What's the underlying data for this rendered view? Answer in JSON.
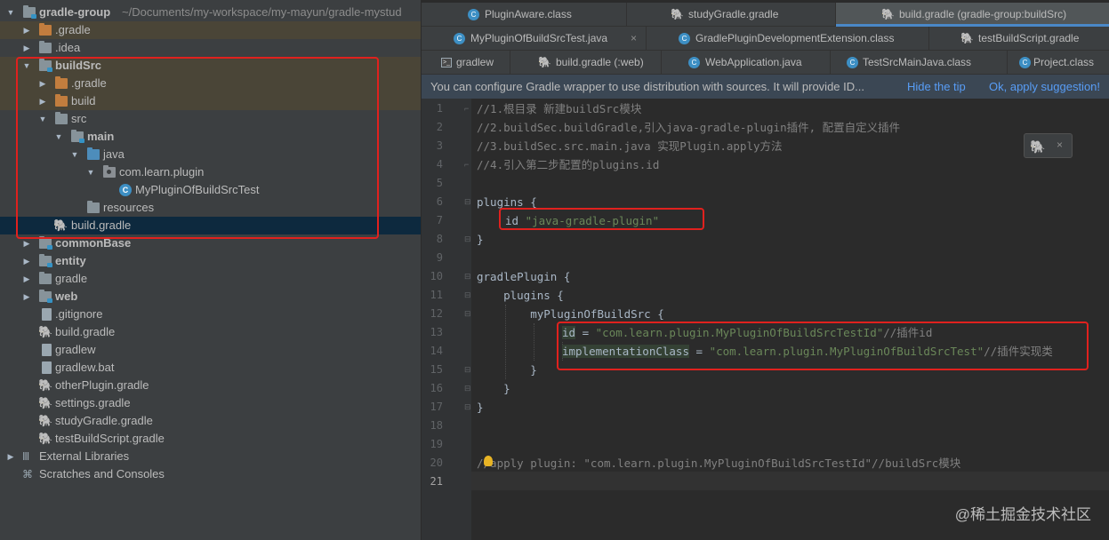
{
  "project": {
    "root_name": "gradle-group",
    "root_path": "~/Documents/my-workspace/my-mayun/gradle-mystud",
    "items": {
      "gradle_dir": ".gradle",
      "idea": ".idea",
      "buildSrc": "buildSrc",
      "bs_gradle": ".gradle",
      "bs_build": "build",
      "bs_src": "src",
      "bs_main": "main",
      "bs_java": "java",
      "bs_pkg": "com.learn.plugin",
      "bs_class": "MyPluginOfBuildSrcTest",
      "bs_resources": "resources",
      "bs_buildgradle": "build.gradle",
      "commonBase": "commonBase",
      "entity": "entity",
      "gradle": "gradle",
      "web": "web",
      "gitignore": ".gitignore",
      "build_gradle": "build.gradle",
      "gradlew": "gradlew",
      "gradlew_bat": "gradlew.bat",
      "otherPlugin": "otherPlugin.gradle",
      "settings": "settings.gradle",
      "studyGradle": "studyGradle.gradle",
      "testBuildScript": "testBuildScript.gradle",
      "external": "External Libraries",
      "scratches": "Scratches and Consoles"
    }
  },
  "tabs": {
    "row1": [
      "PluginAware.class",
      "studyGradle.gradle",
      "build.gradle (gradle-group:buildSrc)"
    ],
    "row2": [
      "MyPluginOfBuildSrcTest.java",
      "GradlePluginDevelopmentExtension.class",
      "testBuildScript.gradle"
    ],
    "row3": [
      "gradlew",
      "build.gradle (:web)",
      "WebApplication.java",
      "TestSrcMainJava.class",
      "Project.class"
    ]
  },
  "tip": {
    "message": "You can configure Gradle wrapper to use distribution with sources. It will provide ID...",
    "hide": "Hide the tip",
    "apply": "Ok, apply suggestion!"
  },
  "gutter": {
    "numbers": [
      "1",
      "2",
      "3",
      "4",
      "5",
      "6",
      "7",
      "8",
      "9",
      "10",
      "11",
      "12",
      "13",
      "14",
      "15",
      "16",
      "17",
      "18",
      "19",
      "20",
      "21"
    ]
  },
  "code": {
    "l1": "//1.根目录 新建buildSrc模块",
    "l2": "//2.buildSec.buildGradle,引入java-gradle-plugin插件, 配置自定义插件",
    "l3": "//3.buildSec.src.main.java 实现Plugin.apply方法",
    "l4": "//4.引入第二步配置的plugins.id",
    "l6": "plugins {",
    "l7_kw": "id ",
    "l7_str": "\"java-gradle-plugin\"",
    "l8": "}",
    "l10": "gradlePlugin {",
    "l11": "    plugins {",
    "l12": "        myPluginOfBuildSrc {",
    "l13_key": "id",
    "l13_eq": " = ",
    "l13_str": "\"com.learn.plugin.MyPluginOfBuildSrcTestId\"",
    "l13_com": "//插件id",
    "l14_key": "implementationClass",
    "l14_eq": " = ",
    "l14_str": "\"com.learn.plugin.MyPluginOfBuildSrcTest\"",
    "l14_com": "//插件实现类",
    "l15": "        }",
    "l16": "    }",
    "l17": "}",
    "l20": "//apply plugin: \"com.learn.plugin.MyPluginOfBuildSrcTestId\"//buildSrc模块"
  },
  "watermark": "@稀土掘金技术社区",
  "colors": {
    "highlight_box": "#e0211e",
    "link": "#589df6",
    "selection": "#0d293e"
  }
}
